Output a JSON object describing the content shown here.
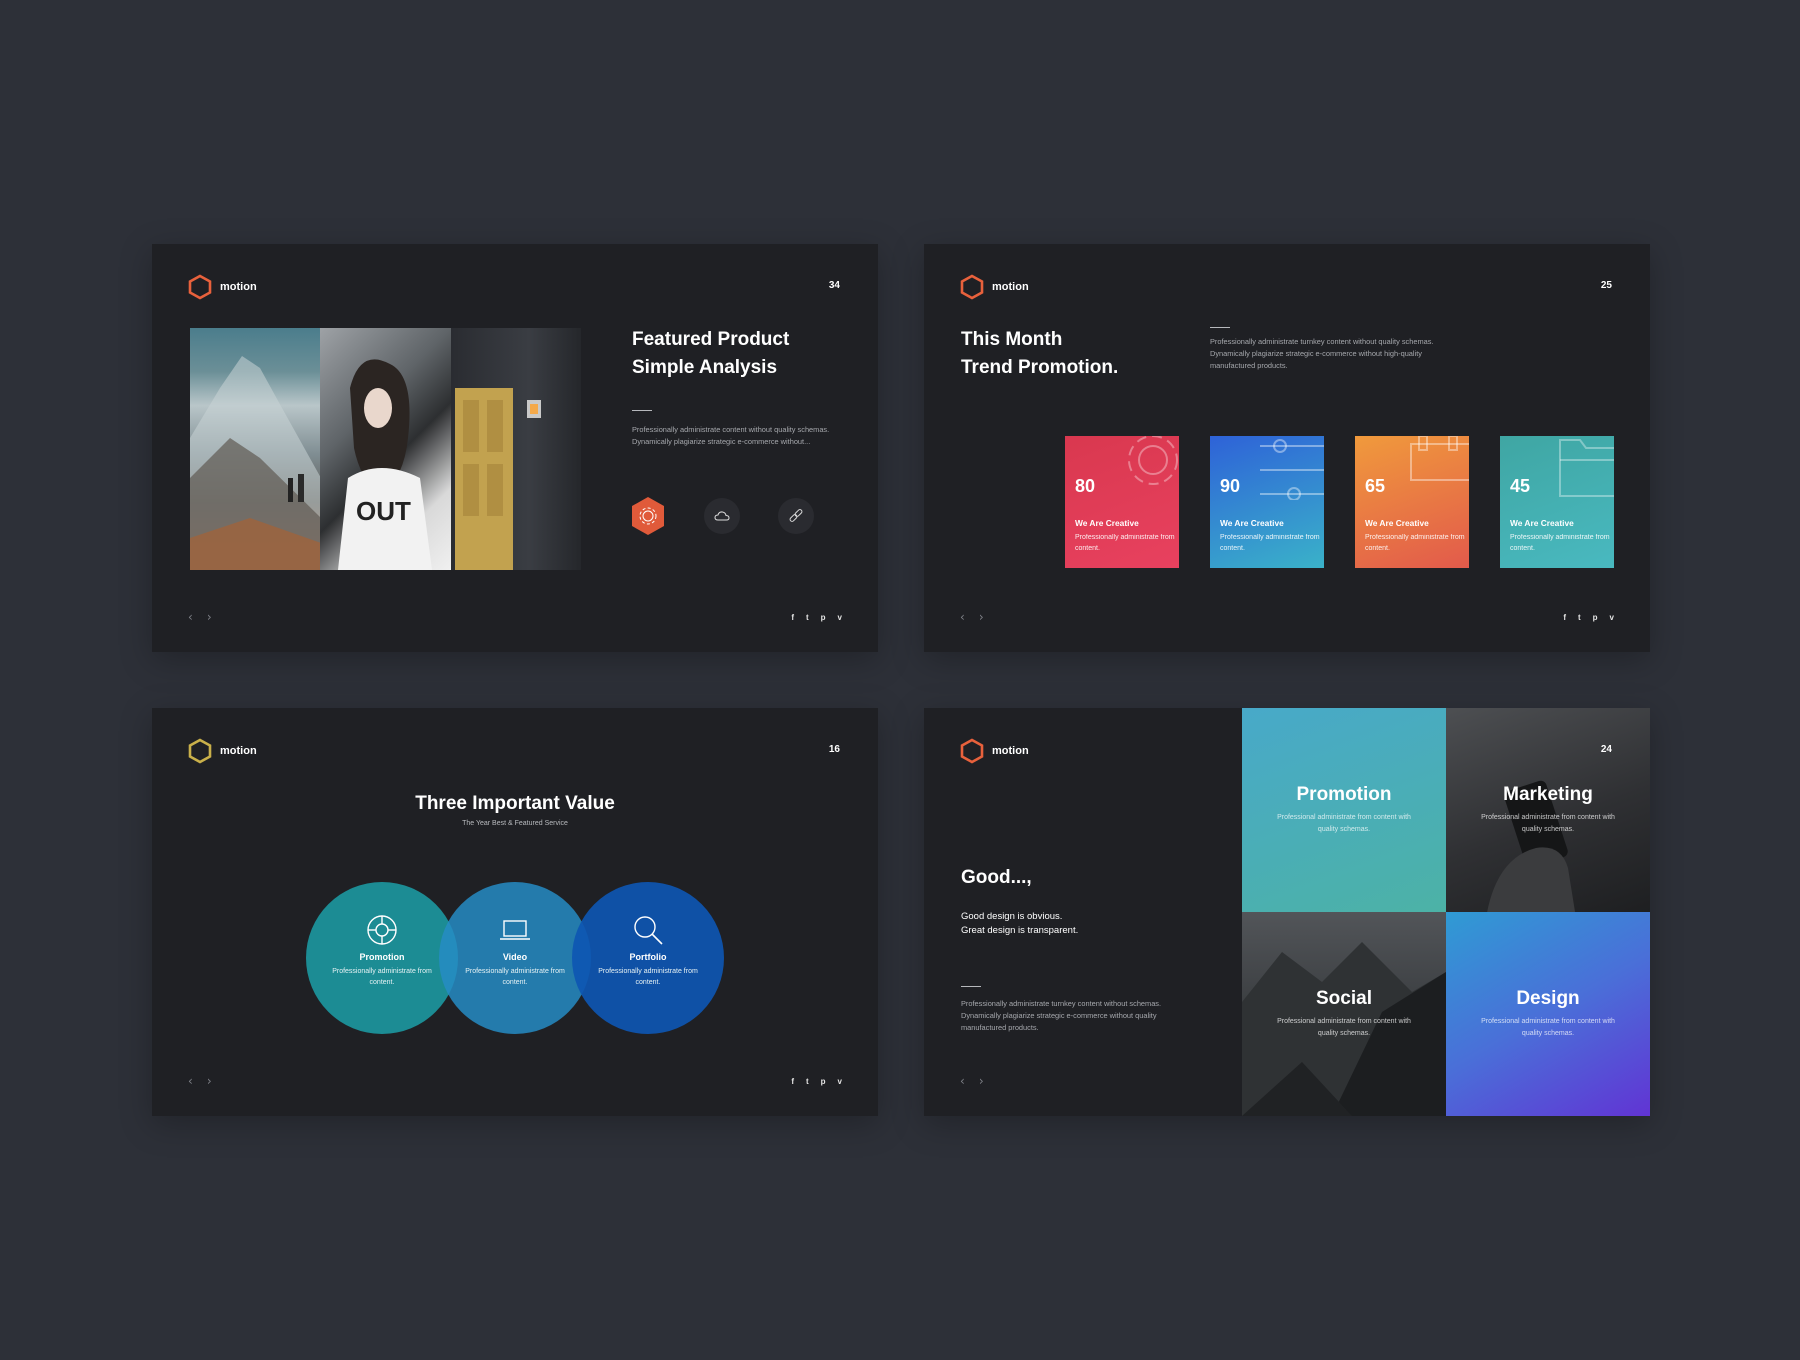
{
  "brand": {
    "name": "motion",
    "logo_color_orange": "#e8613c",
    "logo_color_yellow": "#c9b04a"
  },
  "social_links": [
    "f",
    "t",
    "p",
    "v"
  ],
  "nav": {
    "prev": "‹",
    "next": "›"
  },
  "slide1": {
    "page": "34",
    "title_line1": "Featured Product",
    "title_line2": "Simple Analysis",
    "desc": "Professionally administrate content without quality schemas. Dynamically plagiarize strategic e-commerce without...",
    "icons": [
      "settings-icon",
      "cloud-icon",
      "link-icon"
    ]
  },
  "slide2": {
    "page": "25",
    "title_line1": "This Month",
    "title_line2": "Trend Promotion.",
    "desc": "Professionally administrate turnkey content without quality schemas. Dynamically plagiarize strategic e-commerce without high-quality manufactured products.",
    "cards": [
      {
        "value": "80",
        "title": "We Are Creative",
        "desc": "Professionally administrate from content.",
        "color": "#e0405a"
      },
      {
        "value": "90",
        "title": "We Are Creative",
        "desc": "Professionally administrate from content.",
        "color": "#3585cf"
      },
      {
        "value": "65",
        "title": "We Are Creative",
        "desc": "Professionally administrate from content.",
        "color": "#ea7a43"
      },
      {
        "value": "45",
        "title": "We Are Creative",
        "desc": "Professionally administrate from content.",
        "color": "#43adb0"
      }
    ]
  },
  "slide3": {
    "page": "16",
    "title": "Three Important Value",
    "subtitle": "The Year Best & Featured Service",
    "items": [
      {
        "title": "Promotion",
        "desc": "Professionally administrate from content.",
        "icon": "lifebuoy-icon"
      },
      {
        "title": "Video",
        "desc": "Professionally administrate from content.",
        "icon": "laptop-icon"
      },
      {
        "title": "Portfolio",
        "desc": "Professionally administrate from content.",
        "icon": "search-icon"
      }
    ]
  },
  "slide4": {
    "page": "24",
    "title": "Good...,",
    "lead_line1": "Good design is obvious.",
    "lead_line2": "Great design is transparent.",
    "desc": "Professionally administrate turnkey content without schemas. Dynamically plagiarize strategic e-commerce without quality manufactured products.",
    "tiles": [
      {
        "title": "Promotion",
        "desc": "Professional administrate from content with quality schemas."
      },
      {
        "title": "Marketing",
        "desc": "Professional administrate from content with quality schemas."
      },
      {
        "title": "Social",
        "desc": "Professional administrate from content with quality schemas."
      },
      {
        "title": "Design",
        "desc": "Professional administrate from content with quality schemas."
      }
    ]
  }
}
